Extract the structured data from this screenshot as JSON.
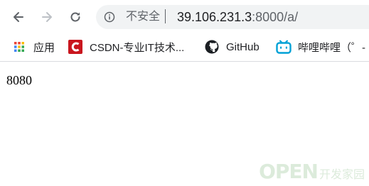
{
  "toolbar": {
    "back_icon": "arrow-left-icon",
    "forward_icon": "arrow-right-icon",
    "reload_icon": "reload-icon",
    "security_text": "不安全",
    "url_host": "39.106.231.3",
    "url_path": ":8000/a/"
  },
  "bookmarks": [
    {
      "label": "应用",
      "icon": "apps-grid-icon"
    },
    {
      "label": "CSDN-专业IT技术...",
      "icon": "csdn-logo-icon"
    },
    {
      "label": "GitHub",
      "icon": "github-logo-icon"
    },
    {
      "label": "哔哩哔哩（゜-",
      "icon": "bilibili-logo-icon"
    }
  ],
  "page": {
    "body_text": "8080"
  },
  "watermark": {
    "big": "OPEN",
    "small": "开发家园"
  },
  "colors": {
    "toolbar_bg": "#ffffff",
    "omnibox_bg": "#f1f3f4",
    "csdn_red": "#c9161e",
    "bilibili_blue": "#00a1d6",
    "watermark_green": "#9cc89a"
  }
}
